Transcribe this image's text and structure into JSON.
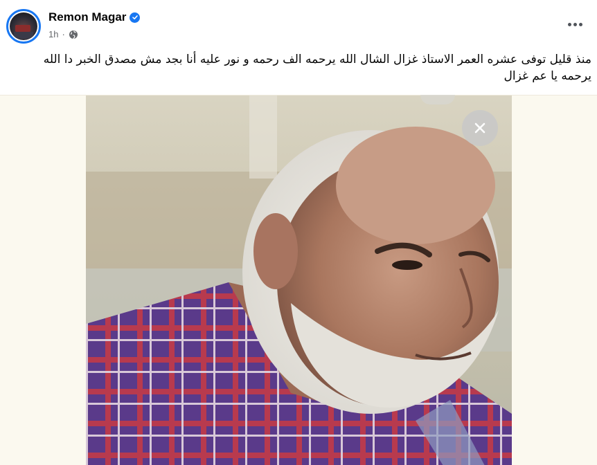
{
  "post": {
    "author": "Remon Magar",
    "time": "1h",
    "separator": "·",
    "text_line1": "منذ قليل توفى عشره العمر الاستاذ غزال الشال الله يرحمه الف رحمه و نور عليه أنا بجد مش مصدق الخبر دا الله",
    "text_line2": "يرحمه يا عم غزال"
  },
  "icons": {
    "verified": "verified-badge-icon",
    "audience": "globe-icon",
    "more": "more-options-icon",
    "close": "close-icon"
  },
  "colors": {
    "accent": "#1877f2",
    "secondary_text": "#65676b",
    "photo_background": "#fbf9ef"
  }
}
